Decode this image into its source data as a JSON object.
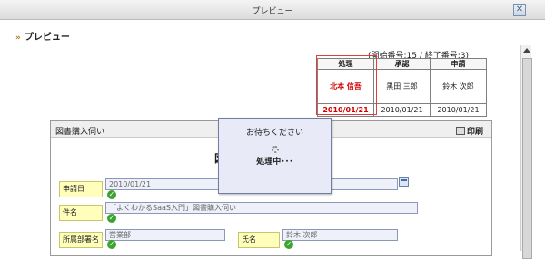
{
  "window": {
    "title": "プレビュー",
    "close_glyph": "✕"
  },
  "page": {
    "heading": "プレビュー",
    "chevron": "»"
  },
  "sequence": "(開始番号:15 / 終了番号:3)",
  "approval": {
    "headers": [
      "処理",
      "承認",
      "申請"
    ],
    "names": [
      "北本 信吾",
      "黒田 三郎",
      "鈴木 次郎"
    ],
    "dates": [
      "2010/01/21",
      "2010/01/21",
      "2010/01/21"
    ]
  },
  "form": {
    "title": "図書購入伺い",
    "print_label": "印刷",
    "partial_title_char": "図",
    "fields": {
      "date_label": "申請日",
      "date_value": "2010/01/21",
      "subject_label": "件名",
      "subject_value": "「よくわかるSaaS入門」図書購入伺い",
      "dept_label": "所属部署名",
      "dept_value": "営業部",
      "name_label": "氏名",
      "name_value": "鈴木 次郎"
    }
  },
  "loading": {
    "title": "お待ちください",
    "message": "処理中･･･"
  }
}
